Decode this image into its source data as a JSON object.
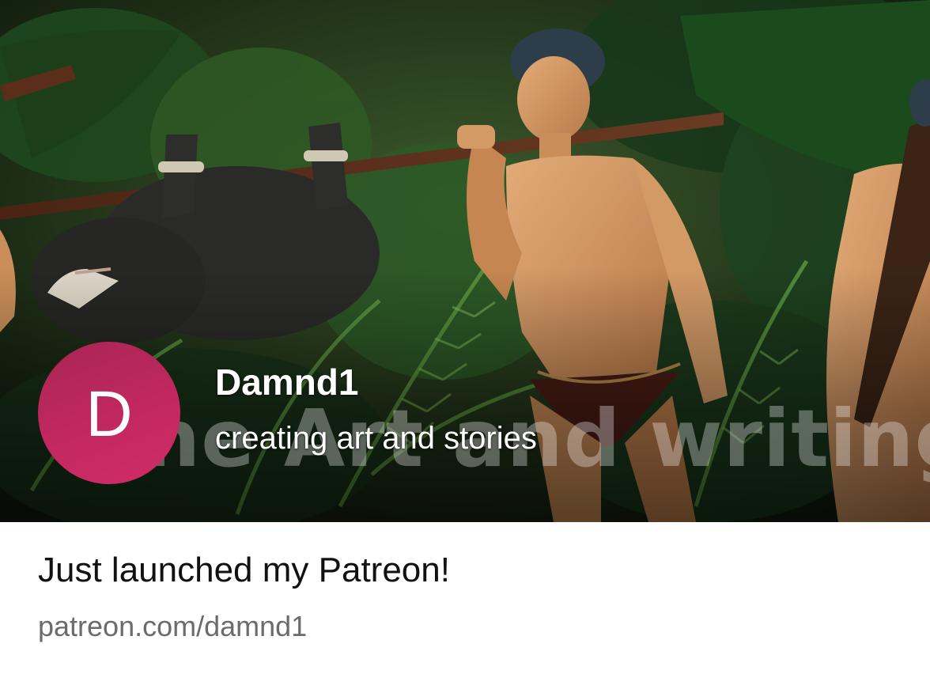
{
  "banner": {
    "watermark_text": "he Art and writing"
  },
  "creator": {
    "avatar_letter": "D",
    "name": "Damnd1",
    "tagline": "creating art and stories"
  },
  "link": {
    "title": "Just launched my Patreon!",
    "url": "patreon.com/damnd1"
  },
  "colors": {
    "avatar_accent": "#c2285f",
    "url_gray": "#6b6b6b"
  }
}
